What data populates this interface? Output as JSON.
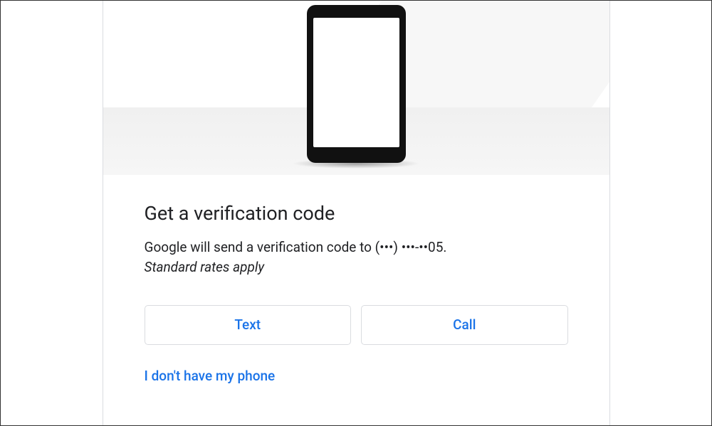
{
  "heading": "Get a verification code",
  "description": "Google will send a verification code to (•••) •••-••05.",
  "rates_notice": "Standard rates apply",
  "buttons": {
    "text": "Text",
    "call": "Call"
  },
  "alt_link": "I don't have my phone"
}
